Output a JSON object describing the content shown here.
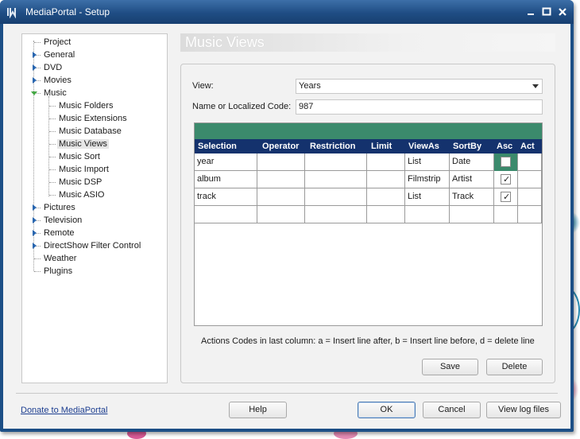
{
  "window": {
    "title": "MediaPortal - Setup",
    "buttons": [
      "minimize",
      "maximize",
      "close"
    ]
  },
  "tree": {
    "items": [
      {
        "label": "Project",
        "level": 0,
        "expander": "none"
      },
      {
        "label": "General",
        "level": 0,
        "expander": "collapsed"
      },
      {
        "label": "DVD",
        "level": 0,
        "expander": "collapsed"
      },
      {
        "label": "Movies",
        "level": 0,
        "expander": "collapsed"
      },
      {
        "label": "Music",
        "level": 0,
        "expander": "expanded"
      },
      {
        "label": "Music Folders",
        "level": 1,
        "expander": "none"
      },
      {
        "label": "Music Extensions",
        "level": 1,
        "expander": "none"
      },
      {
        "label": "Music Database",
        "level": 1,
        "expander": "none"
      },
      {
        "label": "Music Views",
        "level": 1,
        "expander": "none",
        "selected": true
      },
      {
        "label": "Music Sort",
        "level": 1,
        "expander": "none"
      },
      {
        "label": "Music Import",
        "level": 1,
        "expander": "none"
      },
      {
        "label": "Music DSP",
        "level": 1,
        "expander": "none"
      },
      {
        "label": "Music ASIO",
        "level": 1,
        "expander": "none"
      },
      {
        "label": "Pictures",
        "level": 0,
        "expander": "collapsed"
      },
      {
        "label": "Television",
        "level": 0,
        "expander": "collapsed"
      },
      {
        "label": "Remote",
        "level": 0,
        "expander": "collapsed"
      },
      {
        "label": "DirectShow Filter Control",
        "level": 0,
        "expander": "collapsed"
      },
      {
        "label": "Weather",
        "level": 0,
        "expander": "none"
      },
      {
        "label": "Plugins",
        "level": 0,
        "expander": "none"
      }
    ]
  },
  "section": {
    "title": "Music Views",
    "view_label": "View:",
    "view_value": "Years",
    "code_label": "Name or Localized Code:",
    "code_value": "987"
  },
  "grid": {
    "columns": [
      "Selection",
      "Operator",
      "Restriction",
      "Limit",
      "ViewAs",
      "SortBy",
      "Asc",
      "Act"
    ],
    "rows": [
      {
        "selection": "year",
        "operator": "",
        "restriction": "",
        "limit": "",
        "viewas": "List",
        "sortby": "Date",
        "asc": false,
        "act": ""
      },
      {
        "selection": "album",
        "operator": "",
        "restriction": "",
        "limit": "",
        "viewas": "Filmstrip",
        "sortby": "Artist",
        "asc": true,
        "act": ""
      },
      {
        "selection": "track",
        "operator": "",
        "restriction": "",
        "limit": "",
        "viewas": "List",
        "sortby": "Track",
        "asc": true,
        "act": ""
      },
      {
        "selection": "",
        "operator": "",
        "restriction": "",
        "limit": "",
        "viewas": "",
        "sortby": "",
        "asc": null,
        "act": ""
      }
    ],
    "footnote": "Actions Codes in last column: a = Insert line after, b = Insert line before, d = delete line"
  },
  "panel_buttons": {
    "save": "Save",
    "delete": "Delete"
  },
  "footer": {
    "donate_link": "Donate to MediaPortal",
    "help": "Help",
    "ok": "OK",
    "cancel": "Cancel",
    "view_log": "View log files"
  },
  "colors": {
    "title_bar": "#1f4d84",
    "grid_header": "#14326d",
    "grid_band": "#3b8a6c",
    "link": "#1d3f91"
  }
}
